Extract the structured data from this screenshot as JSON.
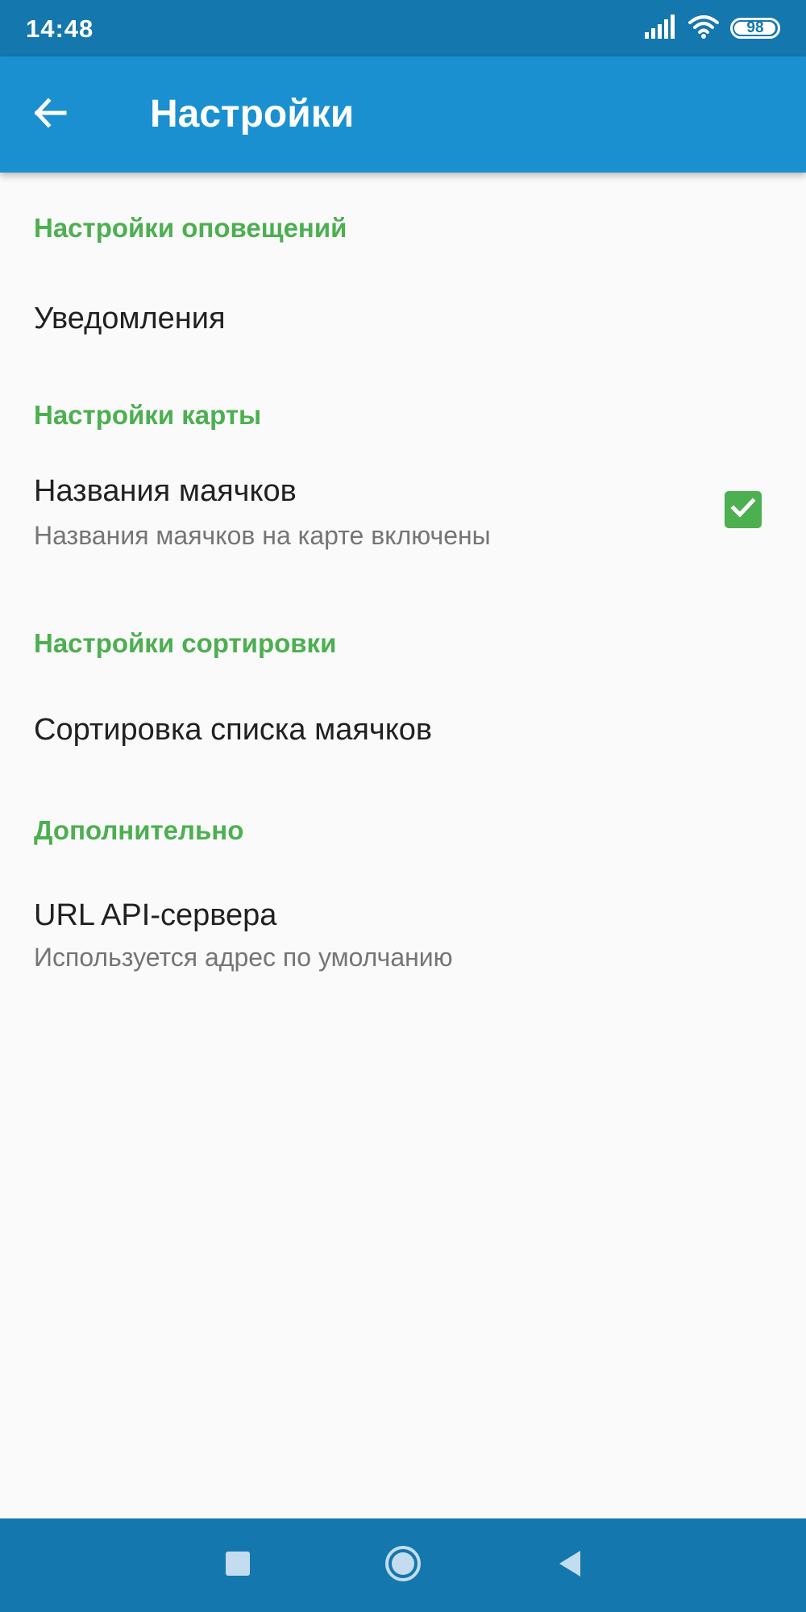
{
  "status_bar": {
    "time": "14:48",
    "battery_level": "98",
    "icons": [
      "signal-icon",
      "wifi-icon",
      "battery-icon"
    ]
  },
  "app_bar": {
    "back_icon": "arrow-back-icon",
    "title": "Настройки"
  },
  "sections": [
    {
      "header": "Настройки оповещений",
      "items": [
        {
          "title": "Уведомления"
        }
      ]
    },
    {
      "header": "Настройки карты",
      "items": [
        {
          "title": "Названия маячков",
          "summary": "Названия маячков на карте включены",
          "checked": true
        }
      ]
    },
    {
      "header": "Настройки сортировки",
      "items": [
        {
          "title": "Сортировка списка маячков"
        }
      ]
    },
    {
      "header": "Дополнительно",
      "items": [
        {
          "title": "URL API-сервера",
          "summary": "Используется адрес по умолчанию"
        }
      ]
    }
  ],
  "nav_bar": {
    "icons": [
      "recents-square-icon",
      "home-circle-icon",
      "back-triangle-icon"
    ]
  },
  "colors": {
    "status_bar": "#1477ad",
    "app_bar": "#1a90d0",
    "accent_green": "#4caf50",
    "background": "#fafafa",
    "title_text": "#212121",
    "summary_text": "#757575"
  }
}
